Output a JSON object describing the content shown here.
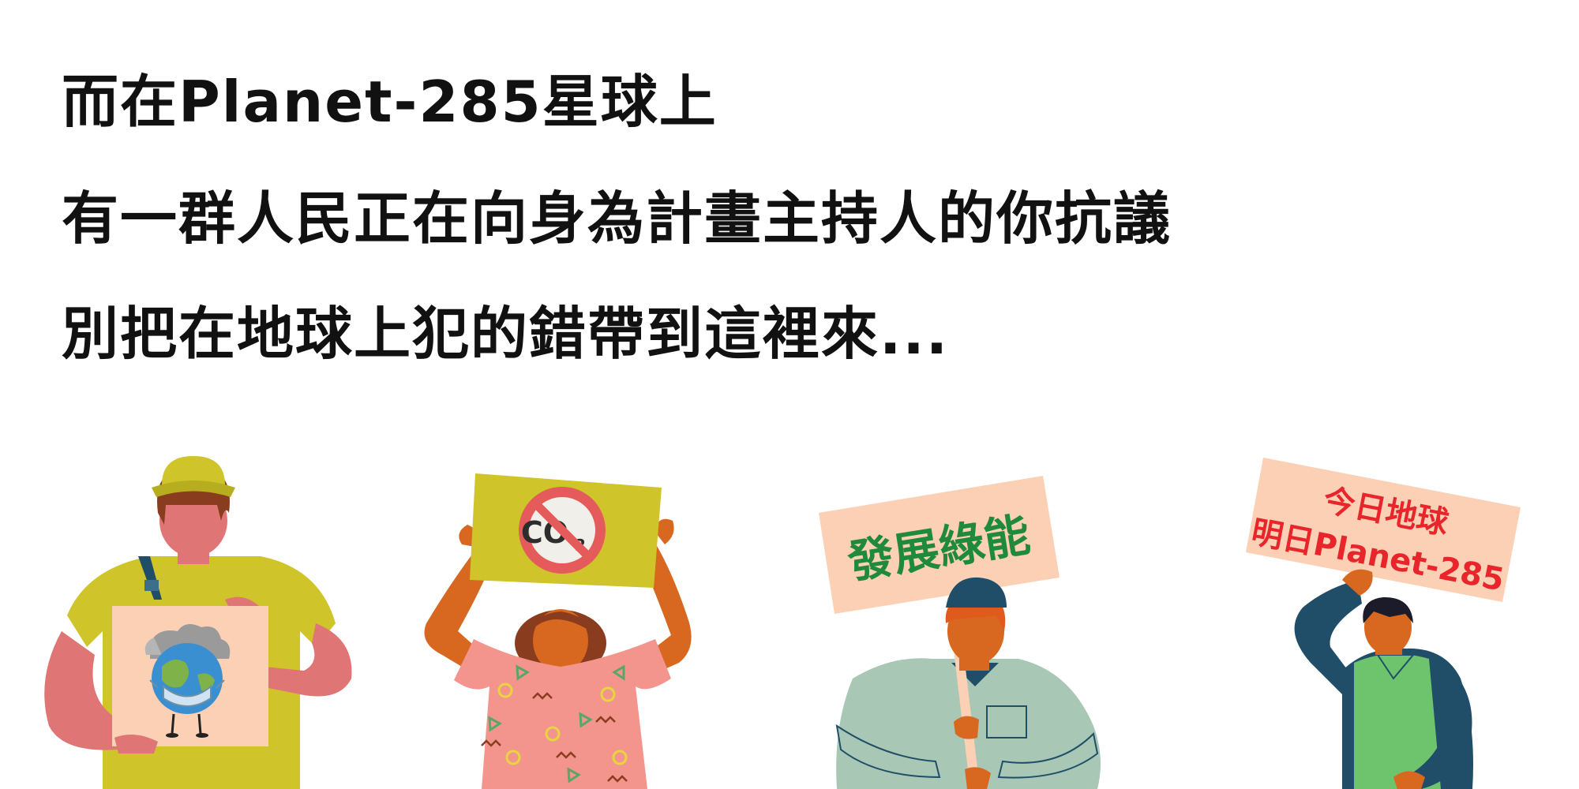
{
  "headline": {
    "line1": "而在Planet-285星球上",
    "line2": "有一群人民正在向身為計畫主持人的你抗議",
    "line3": "別把在地球上犯的錯帶到這裡來..."
  },
  "signs": {
    "co2_label": "CO",
    "co2_subscript": "2",
    "green_energy": "發展綠能",
    "earth_today_line1": "今日地球",
    "earth_today_line2": "明日Planet-285"
  },
  "colors": {
    "sign_peach": "#fbd0b4",
    "sign_mustard": "#cfc42a",
    "green_text": "#1f8a3c",
    "red_text": "#e8252b",
    "navy": "#204e69",
    "skin_orange": "#d8671f"
  }
}
